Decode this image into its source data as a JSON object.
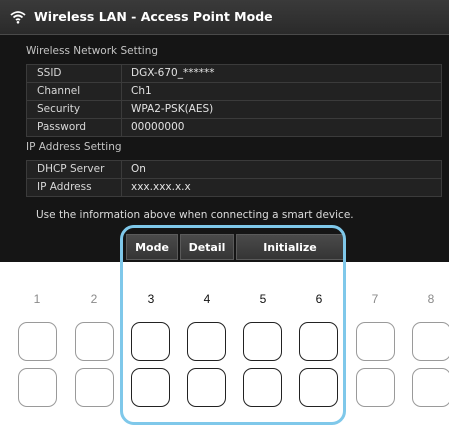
{
  "window": {
    "title": "Wireless LAN - Access Point Mode"
  },
  "wireless_network": {
    "heading": "Wireless Network Setting",
    "rows": [
      {
        "key": "SSID",
        "value": "DGX-670_******"
      },
      {
        "key": "Channel",
        "value": "Ch1"
      },
      {
        "key": "Security",
        "value": "WPA2-PSK(AES)"
      },
      {
        "key": "Password",
        "value": "00000000"
      }
    ]
  },
  "ip_address": {
    "heading": "IP Address Setting",
    "rows": [
      {
        "key": "DHCP Server",
        "value": "On"
      },
      {
        "key": "IP Address",
        "value": "xxx.xxx.x.x"
      }
    ]
  },
  "info": {
    "text": "Use the information above when connecting a smart device."
  },
  "tabs": {
    "mode": "Mode",
    "detail": "Detail",
    "initialize": "Initialize"
  },
  "panel": {
    "numbers": [
      "1",
      "2",
      "3",
      "4",
      "5",
      "6",
      "7",
      "8"
    ],
    "active_columns": [
      3,
      4,
      5,
      6
    ]
  },
  "colors": {
    "highlight": "#7fc8ea",
    "screen_bg": "#151515"
  },
  "icons": {
    "title_icon": "wifi-icon"
  }
}
